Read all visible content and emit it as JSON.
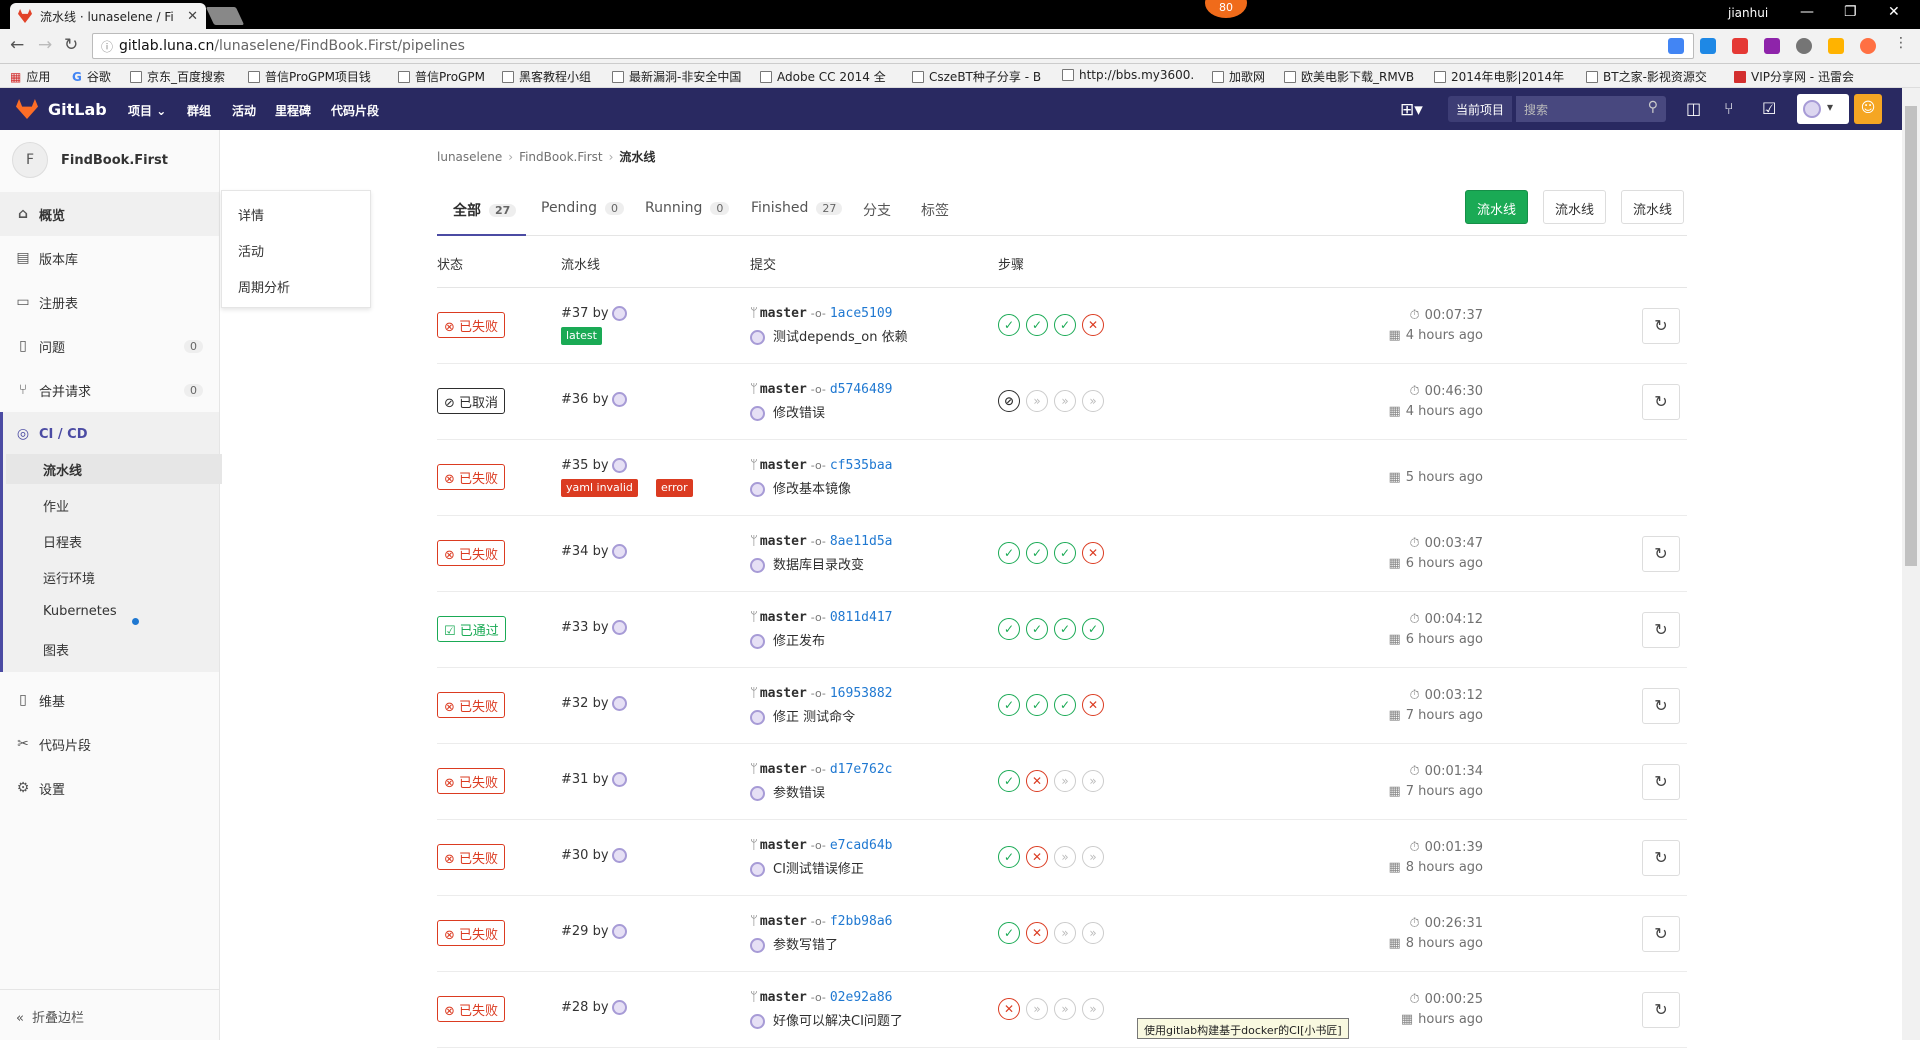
{
  "browser": {
    "tab_title": "流水线 · lunaselene / Fi",
    "badge": "80",
    "window_user": "jianhui",
    "url_host": "gitlab.luna.cn",
    "url_path": "/lunaselene/FindBook.First/pipelines",
    "bookmarks": [
      "应用",
      "谷歌",
      "京东_百度搜索",
      "普信ProGPM项目钱",
      "普信ProGPM",
      "黑客教程小组",
      "最新漏洞-非安全中国",
      "Adobe CC 2014 全",
      "CszeBT种子分享 - B",
      "http://bbs.my3600.",
      "加歌网",
      "欧美电影下载_RMVB",
      "2014年电影|2014年",
      "BT之家-影视资源交",
      "VIP分享网 - 迅雷会"
    ]
  },
  "header": {
    "brand": "GitLab",
    "nav": [
      "项目",
      "群组",
      "活动",
      "里程碑",
      "代码片段"
    ],
    "search_scope": "当前项目",
    "search_placeholder": "搜索"
  },
  "sidebar": {
    "project_initial": "F",
    "project_name": "FindBook.First",
    "items": [
      {
        "label": "概览",
        "icon": "home-icon"
      },
      {
        "label": "版本库",
        "icon": "repo-icon"
      },
      {
        "label": "注册表",
        "icon": "registry-icon"
      },
      {
        "label": "问题",
        "icon": "issues-icon",
        "count": "0"
      },
      {
        "label": "合并请求",
        "icon": "merge-request-icon",
        "count": "0"
      },
      {
        "label": "CI / CD",
        "icon": "rocket-icon"
      },
      {
        "label": "维基",
        "icon": "book-icon"
      },
      {
        "label": "代码片段",
        "icon": "snippet-icon"
      },
      {
        "label": "设置",
        "icon": "gear-icon"
      }
    ],
    "cicd_sub": [
      "流水线",
      "作业",
      "日程表",
      "运行环境",
      "Kubernetes",
      "图表"
    ],
    "collapse": "折叠边栏"
  },
  "flyout": [
    "详情",
    "活动",
    "周期分析"
  ],
  "breadcrumb": [
    "lunaselene",
    "FindBook.First",
    "流水线"
  ],
  "tabs": [
    {
      "label": "全部",
      "count": "27"
    },
    {
      "label": "Pending",
      "count": "0"
    },
    {
      "label": "Running",
      "count": "0"
    },
    {
      "label": "Finished",
      "count": "27"
    },
    {
      "label": "分支"
    },
    {
      "label": "标签"
    }
  ],
  "top_buttons": [
    "流水线",
    "流水线",
    "流水线"
  ],
  "columns": [
    "状态",
    "流水线",
    "提交",
    "步骤"
  ],
  "pipelines": [
    {
      "status": "已失败",
      "kind": "failed",
      "id": "#37 by",
      "labels": [
        "latest"
      ],
      "branch": "master",
      "sha": "1ace5109",
      "message": "测试depends_on 依赖",
      "stages": [
        "success",
        "success",
        "success",
        "failed"
      ],
      "duration": "00:07:37",
      "finished": "4 hours ago"
    },
    {
      "status": "已取消",
      "kind": "canceled",
      "id": "#36 by",
      "labels": [],
      "branch": "master",
      "sha": "d5746489",
      "message": "修改错误",
      "stages": [
        "canceled",
        "skipped",
        "skipped",
        "skipped"
      ],
      "duration": "00:46:30",
      "finished": "4 hours ago"
    },
    {
      "status": "已失败",
      "kind": "failed",
      "id": "#35 by",
      "labels": [
        "yaml invalid",
        "error"
      ],
      "branch": "master",
      "sha": "cf535baa",
      "message": "修改基本镜像",
      "stages": [],
      "duration": "",
      "finished": "5 hours ago"
    },
    {
      "status": "已失败",
      "kind": "failed",
      "id": "#34 by",
      "labels": [],
      "branch": "master",
      "sha": "8ae11d5a",
      "message": "数据库目录改变",
      "stages": [
        "success",
        "success",
        "success",
        "failed"
      ],
      "duration": "00:03:47",
      "finished": "6 hours ago"
    },
    {
      "status": "已通过",
      "kind": "passed",
      "id": "#33 by",
      "labels": [],
      "branch": "master",
      "sha": "0811d417",
      "message": "修正发布",
      "stages": [
        "success",
        "success",
        "success",
        "success"
      ],
      "duration": "00:04:12",
      "finished": "6 hours ago"
    },
    {
      "status": "已失败",
      "kind": "failed",
      "id": "#32 by",
      "labels": [],
      "branch": "master",
      "sha": "16953882",
      "message": "修正 测试命令",
      "stages": [
        "success",
        "success",
        "success",
        "failed"
      ],
      "duration": "00:03:12",
      "finished": "7 hours ago"
    },
    {
      "status": "已失败",
      "kind": "failed",
      "id": "#31 by",
      "labels": [],
      "branch": "master",
      "sha": "d17e762c",
      "message": "参数错误",
      "stages": [
        "success",
        "failed",
        "skipped",
        "skipped"
      ],
      "duration": "00:01:34",
      "finished": "7 hours ago"
    },
    {
      "status": "已失败",
      "kind": "failed",
      "id": "#30 by",
      "labels": [],
      "branch": "master",
      "sha": "e7cad64b",
      "message": "CI测试错误修正",
      "stages": [
        "success",
        "failed",
        "skipped",
        "skipped"
      ],
      "duration": "00:01:39",
      "finished": "8 hours ago"
    },
    {
      "status": "已失败",
      "kind": "failed",
      "id": "#29 by",
      "labels": [],
      "branch": "master",
      "sha": "f2bb98a6",
      "message": "参数写错了",
      "stages": [
        "success",
        "failed",
        "skipped",
        "skipped"
      ],
      "duration": "00:26:31",
      "finished": "8 hours ago"
    },
    {
      "status": "已失败",
      "kind": "failed",
      "id": "#28 by",
      "labels": [],
      "branch": "master",
      "sha": "02e92a86",
      "message": "好像可以解决CI问题了",
      "stages": [
        "failed",
        "skipped",
        "skipped",
        "skipped"
      ],
      "duration": "00:00:25",
      "finished": "hours ago"
    }
  ],
  "tooltip": "使用gitlab构建基于docker的CI[小书匠]",
  "colors": {
    "header": "#292961",
    "failed": "#db3b21",
    "success": "#1aaa55",
    "link": "#1f78d1"
  }
}
